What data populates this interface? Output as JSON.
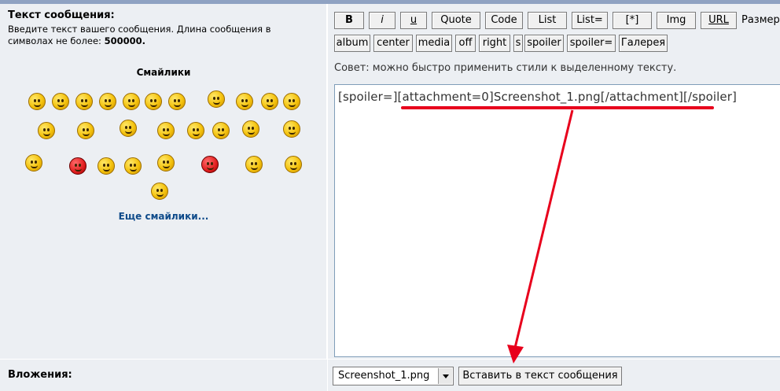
{
  "message": {
    "title": "Текст сообщения:",
    "desc_text": "Введите текст вашего сообщения. Длина сообщения в символах не более:",
    "max_length": "500000."
  },
  "smileys": {
    "title": "Смайлики",
    "more": "Еще смайлики..."
  },
  "toolbar": {
    "row1": [
      "B",
      "i",
      "u",
      "Quote",
      "Code",
      "List",
      "List=",
      "[*]",
      "Img",
      "URL"
    ],
    "size_label": "Размер",
    "row2": [
      "album",
      "center",
      "media",
      "off",
      "right",
      "s",
      "spoiler",
      "spoiler=",
      "Галерея"
    ]
  },
  "tip": "Совет: можно быстро применить стили к выделенному тексту.",
  "editor": {
    "value": "[spoiler=][attachment=0]Screenshot_1.png[/attachment][/spoiler]"
  },
  "attachments": {
    "label": "Вложения:",
    "selected_file": "Screenshot_1.png",
    "insert_button": "Вставить в текст сообщения"
  },
  "colors": {
    "panel_bg": "#eceff3",
    "annotation": "#e8001c",
    "link": "#0f4b8a"
  }
}
